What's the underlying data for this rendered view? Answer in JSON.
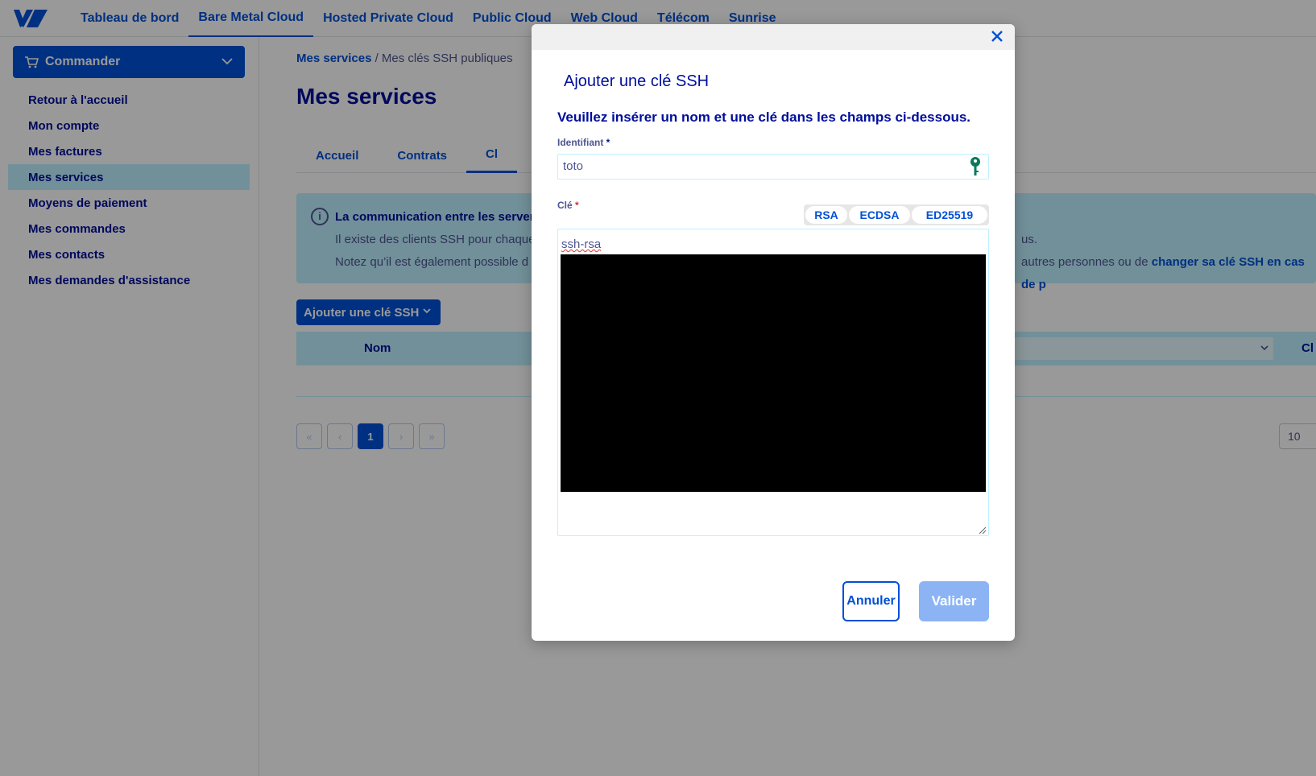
{
  "nav": {
    "items": [
      {
        "label": "Tableau de bord"
      },
      {
        "label": "Bare Metal Cloud"
      },
      {
        "label": "Hosted Private Cloud"
      },
      {
        "label": "Public Cloud"
      },
      {
        "label": "Web Cloud"
      },
      {
        "label": "Télécom"
      },
      {
        "label": "Sunrise"
      }
    ],
    "active_index": 1
  },
  "sidebar": {
    "order_label": "Commander",
    "items": [
      {
        "label": "Retour à l'accueil"
      },
      {
        "label": "Mon compte"
      },
      {
        "label": "Mes factures"
      },
      {
        "label": "Mes services"
      },
      {
        "label": "Moyens de paiement"
      },
      {
        "label": "Mes commandes"
      },
      {
        "label": "Mes contacts"
      },
      {
        "label": "Mes demandes d'assistance"
      }
    ],
    "active_index": 3
  },
  "main": {
    "breadcrumb": {
      "link": "Mes services",
      "separator": "/",
      "current": "Mes clés SSH publiques"
    },
    "title": "Mes services",
    "tabs": [
      {
        "label": "Accueil"
      },
      {
        "label": "Contrats"
      },
      {
        "label": "Cl"
      }
    ],
    "info": {
      "title": "La communication entre les server",
      "line1": "Il existe des clients SSH pour chaque",
      "line2": "Notez qu’il est également possible d",
      "line1_end": "us.",
      "line2_end": "autres personnes ou de",
      "line2_link": "changer sa clé SSH en cas de p"
    },
    "add_button": "Ajouter une clé SSH",
    "table": {
      "col_name": "Nom",
      "col_right": "Cl"
    },
    "pager": {
      "first": "«",
      "prev": "‹",
      "current": "1",
      "next": "›",
      "last": "»"
    },
    "page_size": "10"
  },
  "modal": {
    "title": "Ajouter une clé SSH",
    "description": "Veuillez insérer un nom et une clé dans les champs ci-dessous.",
    "id_label": "Identifiant",
    "id_required": "*",
    "id_value": "toto",
    "key_label": "Clé",
    "key_required": "*",
    "key_types": [
      "RSA",
      "ECDSA",
      "ED25519"
    ],
    "key_value_visible": "ssh-rsa",
    "cancel": "Annuler",
    "submit": "Valider"
  },
  "colors": {
    "primary": "#0050d7",
    "navy": "#000e9c",
    "light_blue": "#bef1ff",
    "disabled": "#8cb4f5"
  }
}
